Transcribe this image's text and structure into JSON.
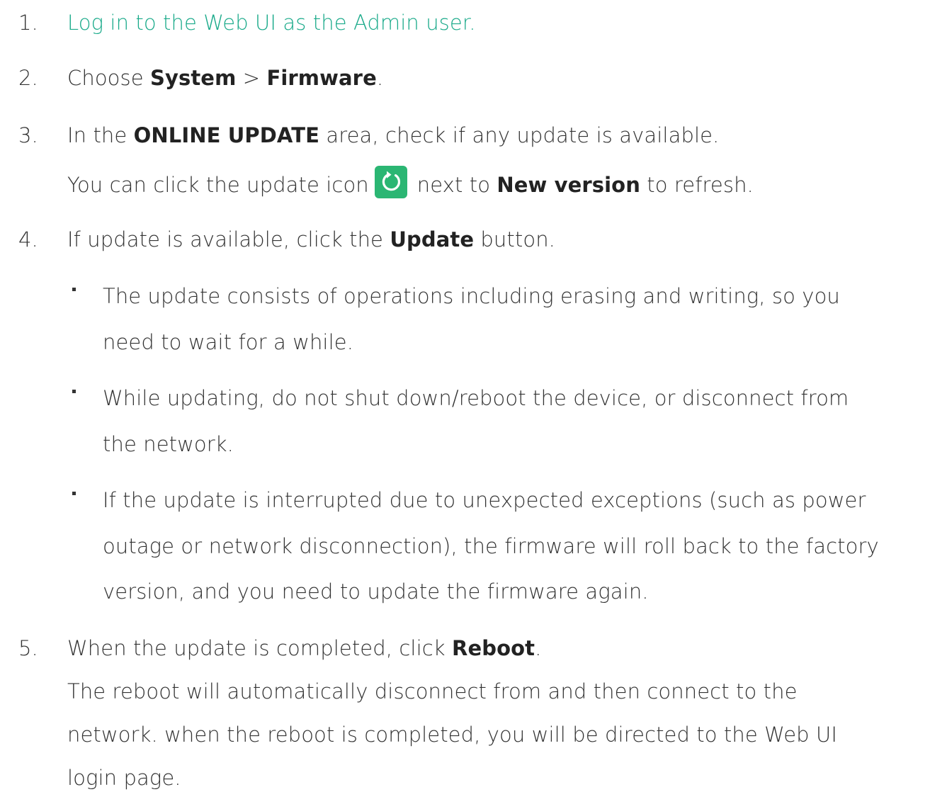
{
  "steps": {
    "s1": {
      "num": "1.",
      "link": "Log in to the Web UI as the Admin user."
    },
    "s2": {
      "num": "2.",
      "pre": "Choose ",
      "b1": "System",
      "mid": " > ",
      "b2": "Firmware",
      "post": "."
    },
    "s3": {
      "num": "3.",
      "pre": "In the ",
      "b1": "ONLINE UPDATE",
      "post": " area, check if any update is available.",
      "l2_pre": "You can click the update icon",
      "l2_mid": "next to ",
      "l2_b": "New version",
      "l2_post": " to refresh."
    },
    "s4": {
      "num": "4.",
      "pre": "If update is available, click the ",
      "b1": "Update",
      "post": " button.",
      "bullets": [
        [
          "The update consists of operations including erasing and writing, so you",
          "need to wait for a while."
        ],
        [
          "While updating, do not shut down/reboot the device, or disconnect from",
          "the network."
        ],
        [
          "If the update is interrupted due to unexpected exceptions (such as power",
          "outage or network disconnection), the firmware will roll back to the factory",
          "version, and you need to update the firmware again."
        ]
      ]
    },
    "s5": {
      "num": "5.",
      "pre": "When the update is completed, click ",
      "b1": "Reboot",
      "post": ".",
      "lines": [
        "The reboot will automatically disconnect from and then connect to the",
        "network. when the reboot is completed, you will be directed to the Web UI",
        "login page."
      ]
    }
  },
  "icons": {
    "refresh": "refresh-icon"
  },
  "colors": {
    "link": "#1aaa8a",
    "icon_bg": "#2bb673",
    "text": "#333333"
  }
}
